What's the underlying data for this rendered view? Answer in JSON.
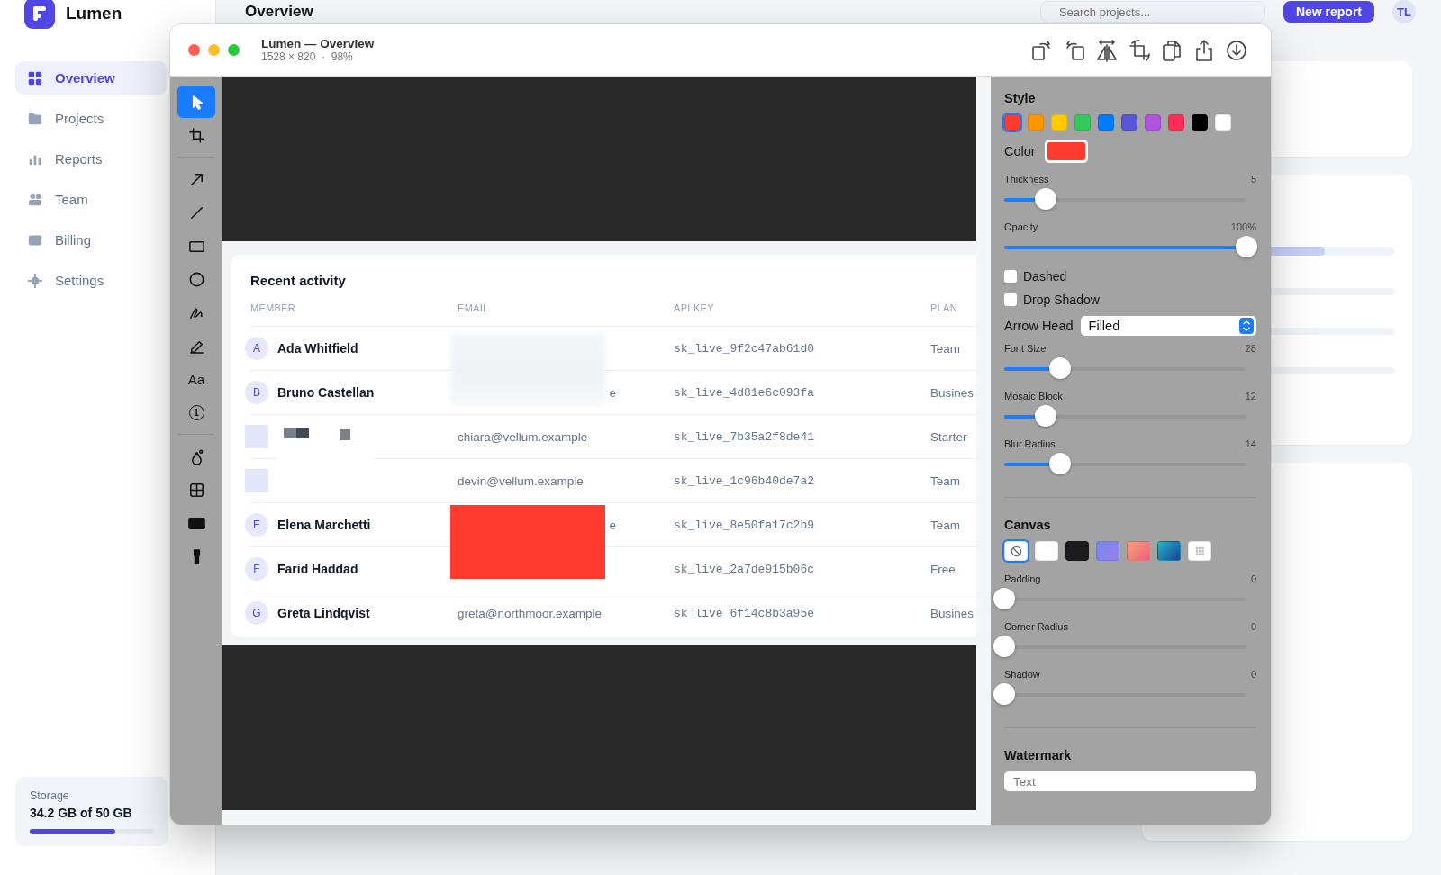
{
  "app": {
    "name": "Lumen",
    "page_title": "Overview",
    "search": {
      "placeholder": "Search projects..."
    },
    "new_button": "New report",
    "avatar": "TL",
    "nav": [
      {
        "label": "Overview",
        "selected": true
      },
      {
        "label": "Projects",
        "selected": false
      },
      {
        "label": "Reports",
        "selected": false
      },
      {
        "label": "Team",
        "selected": false
      },
      {
        "label": "Billing",
        "selected": false
      },
      {
        "label": "Settings",
        "selected": false
      }
    ],
    "storage": {
      "label": "Storage",
      "value": "34.2 GB of 50 GB",
      "level": 0.69
    }
  },
  "window": {
    "title": "Lumen — Overview",
    "subtitle": "1528 × 820  ·  98%",
    "tools": [
      {
        "kind": "cursor",
        "selected": true
      },
      {
        "kind": "crop",
        "selected": false
      },
      {
        "kind": "divider"
      },
      {
        "kind": "arrow",
        "selected": false
      },
      {
        "kind": "line",
        "selected": false
      },
      {
        "kind": "rect",
        "selected": false
      },
      {
        "kind": "ellipse",
        "selected": false
      },
      {
        "kind": "pen",
        "selected": false
      },
      {
        "kind": "highlighter",
        "selected": false
      },
      {
        "kind": "text",
        "label": "Aa",
        "selected": false
      },
      {
        "kind": "counter",
        "label": "1",
        "selected": false
      },
      {
        "kind": "divider"
      },
      {
        "kind": "fill",
        "selected": false
      },
      {
        "kind": "mosaic",
        "selected": false
      },
      {
        "kind": "redact",
        "selected": false
      },
      {
        "kind": "spotlight",
        "selected": false
      }
    ],
    "canvas": {
      "title": "Recent activity",
      "columns": [
        "MEMBER",
        "EMAIL",
        "API KEY",
        "PLAN"
      ],
      "rows": [
        {
          "initial": "A",
          "name": "Ada Whitfield",
          "api_key": "sk_live_9f2c47ab61d0",
          "plan": "Team"
        },
        {
          "initial": "B",
          "name": "Bruno Castellan",
          "email": "e",
          "api_key": "sk_live_4d81e6c093fa",
          "plan": "Busines"
        },
        {
          "email": "chiara@vellum.example",
          "api_key": "sk_live_7b35a2f8de41",
          "plan": "Starter"
        },
        {
          "email": "devin@vellum.example",
          "api_key": "sk_live_1c96b40de7a2",
          "plan": "Team"
        },
        {
          "initial": "E",
          "name": "Elena Marchetti",
          "email": "e",
          "api_key": "sk_live_8e50fa17c2b9",
          "plan": "Team"
        },
        {
          "initial": "F",
          "name": "Farid Haddad",
          "api_key": "sk_live_2a7de915b06c",
          "plan": "Free"
        },
        {
          "initial": "G",
          "name": "Greta Lindqvist",
          "email": "greta@northmoor.example",
          "api_key": "sk_live_6f14c8b3a95e",
          "plan": "Busines"
        }
      ],
      "annotations": [
        {
          "kind": "blur"
        },
        {
          "kind": "mosaic"
        },
        {
          "kind": "rect",
          "color": "#ff3b30"
        }
      ]
    },
    "panel": {
      "style_title": "Style",
      "swatches": [
        {
          "color": "#ff3b30",
          "selected": true
        },
        {
          "color": "#ff9500",
          "selected": false
        },
        {
          "color": "#ffcc00",
          "selected": false
        },
        {
          "color": "#34c759",
          "selected": false
        },
        {
          "color": "#007aff",
          "selected": false
        },
        {
          "color": "#5856d6",
          "selected": false
        },
        {
          "color": "#af52de",
          "selected": false
        },
        {
          "color": "#ff2d55",
          "selected": false
        },
        {
          "color": "#000000",
          "selected": false
        },
        {
          "color": "#ffffff",
          "selected": false
        }
      ],
      "color_label": "Color",
      "color": "#ff3b30",
      "controls": [
        {
          "kind": "slider",
          "label": "Thickness",
          "value": "5",
          "level": 0.17
        },
        {
          "kind": "slider",
          "label": "Opacity",
          "value": "100%",
          "level": 1
        },
        {
          "kind": "checkbox",
          "label": "Dashed",
          "checked": false
        },
        {
          "kind": "checkbox",
          "label": "Drop Shadow",
          "checked": false
        },
        {
          "kind": "select",
          "label": "Arrow Head",
          "value": "Filled"
        },
        {
          "kind": "slider",
          "label": "Font Size",
          "value": "28",
          "level": 0.23
        },
        {
          "kind": "slider",
          "label": "Mosaic Block",
          "value": "12",
          "level": 0.17
        },
        {
          "kind": "slider",
          "label": "Blur Radius",
          "value": "14",
          "level": 0.23
        }
      ],
      "canvas_title": "Canvas",
      "backgrounds": [
        {
          "kind": "none",
          "selected": true
        },
        {
          "kind": "solid",
          "color": "#ffffff",
          "selected": false
        },
        {
          "kind": "solid",
          "color": "#1c1c1e",
          "selected": false
        },
        {
          "kind": "gradient",
          "color": "#7b7ff0",
          "selected": false
        },
        {
          "kind": "gradient",
          "color": "#f47a7a",
          "selected": false
        },
        {
          "kind": "gradient",
          "color": "#1f8fb5",
          "selected": false
        },
        {
          "kind": "pattern",
          "selected": false
        }
      ],
      "canvas_controls": [
        {
          "kind": "slider",
          "label": "Padding",
          "value": "0",
          "level": 0
        },
        {
          "kind": "slider",
          "label": "Corner Radius",
          "value": "0",
          "level": 0
        },
        {
          "kind": "slider",
          "label": "Shadow",
          "value": "0",
          "level": 0
        }
      ],
      "watermark_title": "Watermark",
      "watermark": {
        "placeholder": "Text"
      }
    }
  }
}
